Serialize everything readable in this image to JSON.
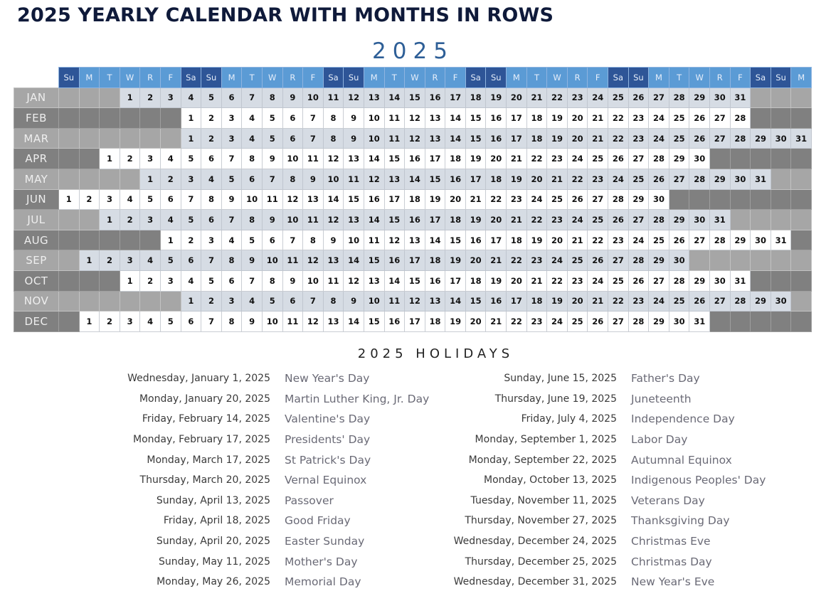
{
  "title": "2025 YEARLY CALENDAR WITH MONTHS IN ROWS",
  "year_label": "2025",
  "colors": {
    "title": "#0f1a3a",
    "year": "#2e5f97",
    "header_weekday": "#5b9bd5",
    "header_weekend": "#2e5597",
    "odd_month_label": "#a6a6a6",
    "even_month_label": "#808080",
    "odd_month_day": "#d6dce4",
    "even_month_day": "#ffffff"
  },
  "calendar": {
    "weekday_headers": [
      "Su",
      "M",
      "T",
      "W",
      "R",
      "F",
      "Sa",
      "Su",
      "M",
      "T",
      "W",
      "R",
      "F",
      "Sa",
      "Su",
      "M",
      "T",
      "W",
      "R",
      "F",
      "Sa",
      "Su",
      "M",
      "T",
      "W",
      "R",
      "F",
      "Sa",
      "Su",
      "M",
      "T",
      "W",
      "R",
      "F",
      "Sa",
      "Su",
      "M"
    ],
    "months": [
      {
        "label": "JAN",
        "offset": 3,
        "days": 31
      },
      {
        "label": "FEB",
        "offset": 6,
        "days": 28
      },
      {
        "label": "MAR",
        "offset": 6,
        "days": 31
      },
      {
        "label": "APR",
        "offset": 2,
        "days": 30
      },
      {
        "label": "MAY",
        "offset": 4,
        "days": 31
      },
      {
        "label": "JUN",
        "offset": 0,
        "days": 30
      },
      {
        "label": "JUL",
        "offset": 2,
        "days": 31
      },
      {
        "label": "AUG",
        "offset": 5,
        "days": 31
      },
      {
        "label": "SEP",
        "offset": 1,
        "days": 30
      },
      {
        "label": "OCT",
        "offset": 3,
        "days": 31
      },
      {
        "label": "NOV",
        "offset": 6,
        "days": 30
      },
      {
        "label": "DEC",
        "offset": 1,
        "days": 31
      }
    ]
  },
  "holidays": {
    "title": "2025 HOLIDAYS",
    "left": [
      {
        "date": "Wednesday, January 1, 2025",
        "name": "New Year's Day"
      },
      {
        "date": "Monday, January 20, 2025",
        "name": "Martin Luther King, Jr. Day"
      },
      {
        "date": "Friday, February 14, 2025",
        "name": "Valentine's Day"
      },
      {
        "date": "Monday, February 17, 2025",
        "name": "Presidents' Day"
      },
      {
        "date": "Monday, March 17, 2025",
        "name": "St Patrick's Day"
      },
      {
        "date": "Thursday, March 20, 2025",
        "name": "Vernal Equinox"
      },
      {
        "date": "Sunday, April 13, 2025",
        "name": "Passover"
      },
      {
        "date": "Friday, April 18, 2025",
        "name": "Good Friday"
      },
      {
        "date": "Sunday, April 20, 2025",
        "name": "Easter Sunday"
      },
      {
        "date": "Sunday, May 11, 2025",
        "name": "Mother's Day"
      },
      {
        "date": "Monday, May 26, 2025",
        "name": "Memorial Day"
      }
    ],
    "right": [
      {
        "date": "Sunday, June 15, 2025",
        "name": "Father's Day"
      },
      {
        "date": "Thursday, June 19, 2025",
        "name": "Juneteenth"
      },
      {
        "date": "Friday, July 4, 2025",
        "name": "Independence Day"
      },
      {
        "date": "Monday, September 1, 2025",
        "name": "Labor Day"
      },
      {
        "date": "Monday, September 22, 2025",
        "name": "Autumnal Equinox"
      },
      {
        "date": "Monday, October 13, 2025",
        "name": "Indigenous Peoples' Day"
      },
      {
        "date": "Tuesday, November 11, 2025",
        "name": "Veterans Day"
      },
      {
        "date": "Thursday, November 27, 2025",
        "name": "Thanksgiving Day"
      },
      {
        "date": "Wednesday, December 24, 2025",
        "name": "Christmas Eve"
      },
      {
        "date": "Thursday, December 25, 2025",
        "name": "Christmas Day"
      },
      {
        "date": "Wednesday, December 31, 2025",
        "name": "New Year's Eve"
      }
    ]
  }
}
